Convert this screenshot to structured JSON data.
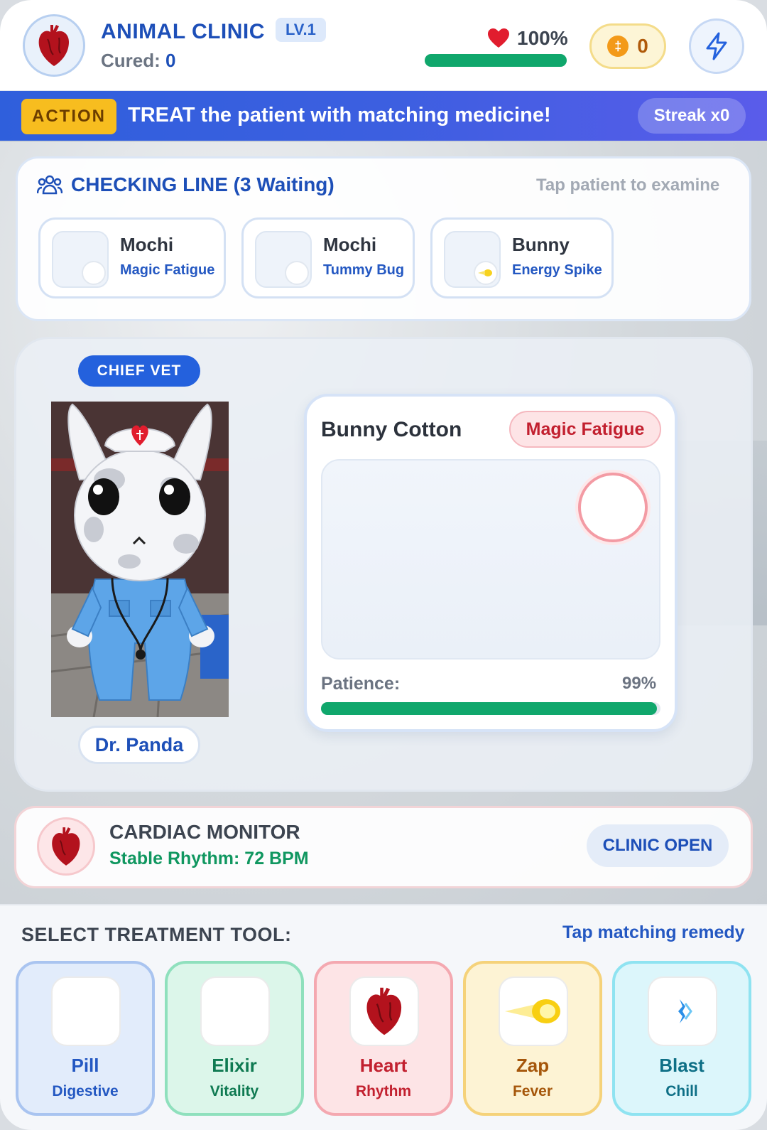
{
  "header": {
    "title": "ANIMAL CLINIC",
    "level": "LV.1",
    "cured_label": "Cured:",
    "cured_count": "0",
    "health_pct": "100%",
    "health_fraction": 1.0,
    "coins": "0"
  },
  "action_bar": {
    "tag": "ACTION",
    "instruction": "TREAT the patient with matching medicine!",
    "streak": "Streak x0"
  },
  "queue": {
    "title": "CHECKING LINE (3 Waiting)",
    "hint": "Tap patient to examine",
    "patients": [
      {
        "name": "Mochi",
        "illness": "Magic Fatigue"
      },
      {
        "name": "Mochi",
        "illness": "Tummy Bug"
      },
      {
        "name": "Bunny",
        "illness": "Energy Spike"
      }
    ]
  },
  "stage": {
    "badge": "CHIEF VET",
    "vet_name": "Dr. Panda",
    "case": {
      "patient_name": "Bunny Cotton",
      "illness": "Magic Fatigue",
      "patience_label": "Patience:",
      "patience_value": "99%",
      "patience_fraction": 0.99
    }
  },
  "monitor": {
    "title": "CARDIAC MONITOR",
    "status": "Stable Rhythm: 72 BPM",
    "clinic_status": "CLINIC OPEN"
  },
  "tools": {
    "title": "SELECT TREATMENT TOOL:",
    "hint": "Tap matching remedy",
    "items": [
      {
        "name": "Pill",
        "sub": "Digestive",
        "icon": "pill-icon",
        "color": "#2458c2",
        "bg": "#e2ecfb",
        "border": "#a9c4f0"
      },
      {
        "name": "Elixir",
        "sub": "Vitality",
        "icon": "elixir-icon",
        "color": "#0f7a52",
        "bg": "#dcf6ea",
        "border": "#8fe0bd"
      },
      {
        "name": "Heart",
        "sub": "Rhythm",
        "icon": "heart-icon",
        "color": "#c2202f",
        "bg": "#fde4e6",
        "border": "#f4a8b0"
      },
      {
        "name": "Zap",
        "sub": "Fever",
        "icon": "zap-icon",
        "color": "#a5560a",
        "bg": "#fdf3d4",
        "border": "#f5d27a"
      },
      {
        "name": "Blast",
        "sub": "Chill",
        "icon": "blast-icon",
        "color": "#0e6f86",
        "bg": "#dcf6fb",
        "border": "#8fe3f1"
      }
    ]
  },
  "colors": {
    "primary": "#1d4fb8",
    "accent_green": "#10a76c",
    "action_yellow": "#f7bd1f",
    "danger_red": "#c2202f"
  }
}
